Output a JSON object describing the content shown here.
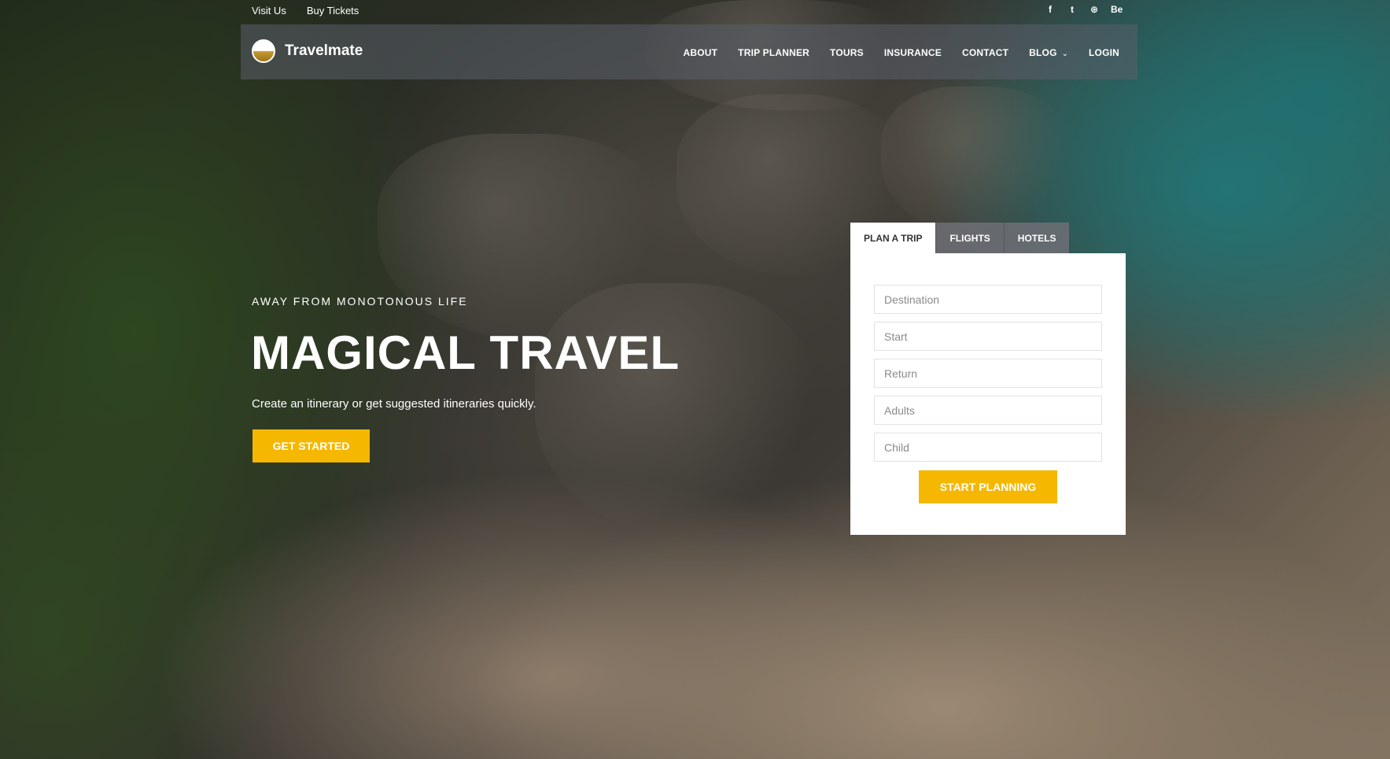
{
  "topbar": {
    "links": [
      "Visit Us",
      "Buy Tickets"
    ],
    "socials": [
      {
        "icon": "facebook-icon",
        "glyph": "f"
      },
      {
        "icon": "twitter-icon",
        "glyph": "t"
      },
      {
        "icon": "dribbble-icon",
        "glyph": "⊛"
      },
      {
        "icon": "behance-icon",
        "glyph": "Be"
      }
    ]
  },
  "nav": {
    "brand": "Travelmate",
    "items": [
      "ABOUT",
      "TRIP PLANNER",
      "TOURS",
      "INSURANCE",
      "CONTACT",
      "BLOG",
      "LOGIN"
    ]
  },
  "hero": {
    "eyebrow": "AWAY FROM MONOTONOUS LIFE",
    "title": "MAGICAL TRAVEL",
    "subtitle": "Create an itinerary or get suggested itineraries quickly.",
    "cta": "GET STARTED"
  },
  "booking": {
    "tabs": [
      "PLAN A TRIP",
      "FLIGHTS",
      "HOTELS"
    ],
    "active_tab": "PLAN A TRIP",
    "fields": {
      "destination": "Destination",
      "start": "Start",
      "return": "Return",
      "adults": "Adults",
      "child": "Child"
    },
    "submit": "START PLANNING"
  },
  "colors": {
    "accent": "#f5b700",
    "nav_bg": "rgba(90,95,105,0.55)"
  }
}
